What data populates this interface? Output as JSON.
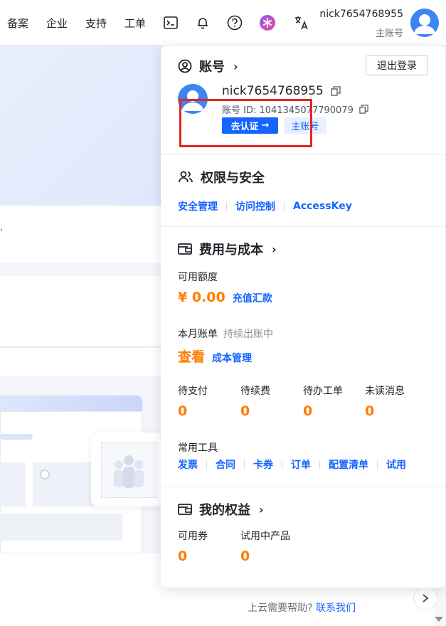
{
  "topnav": {
    "items": [
      "备案",
      "企业",
      "支持",
      "工单"
    ],
    "user_name": "nick7654768955",
    "user_role": "主账号"
  },
  "background": {
    "dot_text": ".",
    "help_text": "上云需要帮助?",
    "help_link": "联系我们"
  },
  "dropdown": {
    "account": {
      "title": "账号",
      "logout_label": "退出登录",
      "name": "nick7654768955",
      "id_label": "账号 ID:",
      "id_value": "1041345077790079",
      "verify_label": "去认证",
      "role_tag": "主账号"
    },
    "security": {
      "title": "权限与安全",
      "links": [
        "安全管理",
        "访问控制",
        "AccessKey"
      ]
    },
    "billing": {
      "title": "费用与成本",
      "available_label": "可用额度",
      "available_value": "¥ 0.00",
      "recharge_link": "充值汇款",
      "monthly_label": "本月账单",
      "monthly_status": "持续出账中",
      "view_link": "查看",
      "cost_link": "成本管理",
      "stats": [
        {
          "label": "待支付",
          "value": "0"
        },
        {
          "label": "待续费",
          "value": "0"
        },
        {
          "label": "待办工单",
          "value": "0"
        },
        {
          "label": "未读消息",
          "value": "0"
        }
      ],
      "tools_label": "常用工具",
      "tools": [
        "发票",
        "合同",
        "卡券",
        "订单",
        "配置清单",
        "试用"
      ]
    },
    "benefits": {
      "title": "我的权益",
      "stats": [
        {
          "label": "可用券",
          "value": "0"
        },
        {
          "label": "试用中产品",
          "value": "0"
        }
      ]
    }
  },
  "colors": {
    "primary": "#1664ff",
    "accent_orange": "#ff7d00",
    "highlight_red": "#e5251f"
  }
}
